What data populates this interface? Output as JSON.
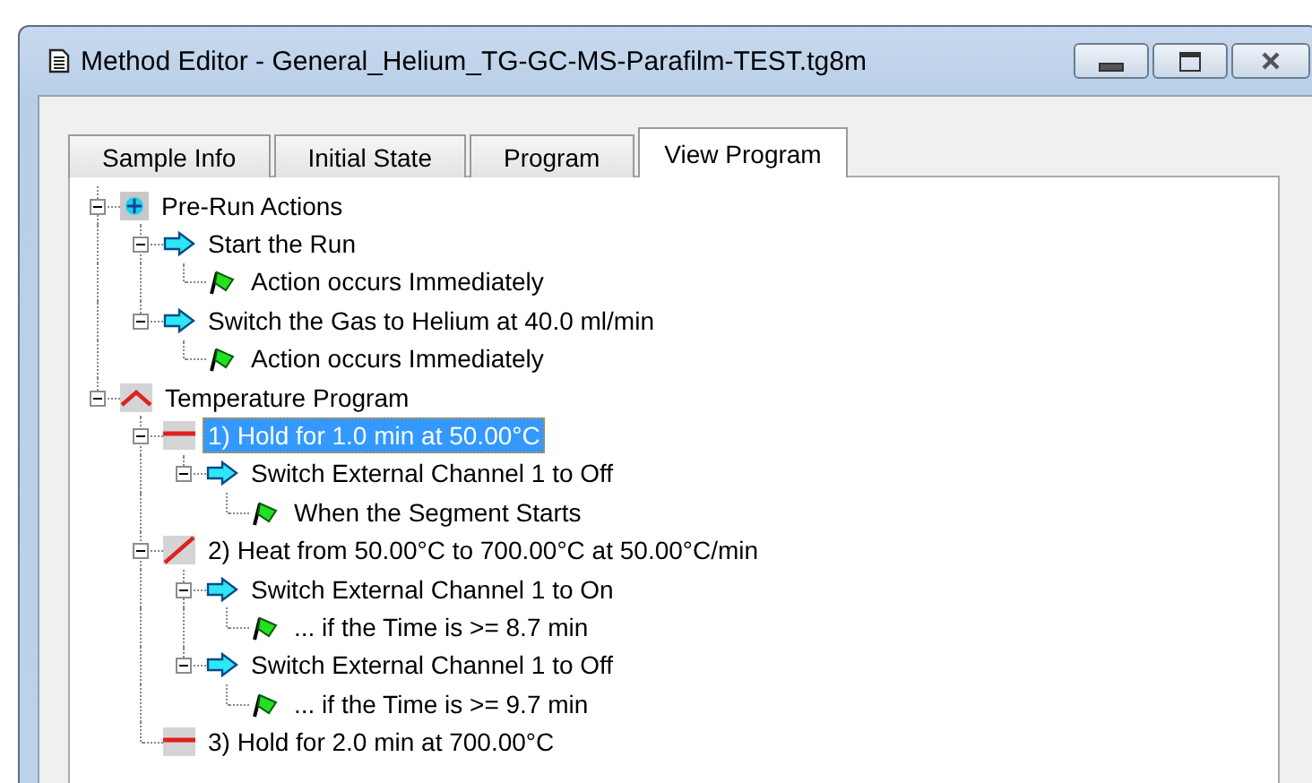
{
  "window": {
    "title": "Method Editor - General_Helium_TG-GC-MS-Parafilm-TEST.tg8m"
  },
  "tabs": [
    {
      "label": "Sample Info",
      "selected": false
    },
    {
      "label": "Initial State",
      "selected": false
    },
    {
      "label": "Program",
      "selected": false
    },
    {
      "label": "View Program",
      "selected": true
    }
  ],
  "tree": [
    {
      "kind": "actions",
      "label": "Pre-Run Actions",
      "expanded": true,
      "selected": false,
      "children": [
        {
          "kind": "action",
          "label": "Start the Run",
          "expanded": true,
          "selected": false,
          "children": [
            {
              "kind": "trigger",
              "label": "Action occurs Immediately",
              "selected": false
            }
          ]
        },
        {
          "kind": "action",
          "label": "Switch the Gas to Helium at 40.0 ml/min",
          "expanded": true,
          "selected": false,
          "children": [
            {
              "kind": "trigger",
              "label": "Action occurs Immediately",
              "selected": false
            }
          ]
        }
      ]
    },
    {
      "kind": "temperature",
      "label": "Temperature Program",
      "expanded": true,
      "selected": false,
      "children": [
        {
          "kind": "hold",
          "label": "1) Hold for 1.0 min at 50.00°C",
          "expanded": true,
          "selected": true,
          "children": [
            {
              "kind": "action",
              "label": "Switch External Channel 1 to Off",
              "expanded": true,
              "selected": false,
              "children": [
                {
                  "kind": "trigger",
                  "label": "When the Segment Starts",
                  "selected": false
                }
              ]
            }
          ]
        },
        {
          "kind": "ramp",
          "label": "2) Heat from 50.00°C to 700.00°C at 50.00°C/min",
          "expanded": true,
          "selected": false,
          "children": [
            {
              "kind": "action",
              "label": "Switch External Channel 1 to On",
              "expanded": true,
              "selected": false,
              "children": [
                {
                  "kind": "trigger",
                  "label": "... if the Time is >= 8.7 min",
                  "selected": false
                }
              ]
            },
            {
              "kind": "action",
              "label": "Switch External Channel 1 to Off",
              "expanded": true,
              "selected": false,
              "children": [
                {
                  "kind": "trigger",
                  "label": "... if the Time is >= 9.7 min",
                  "selected": false
                }
              ]
            }
          ]
        },
        {
          "kind": "hold",
          "label": "3) Hold for 2.0 min at 700.00°C",
          "selected": false
        }
      ]
    }
  ]
}
